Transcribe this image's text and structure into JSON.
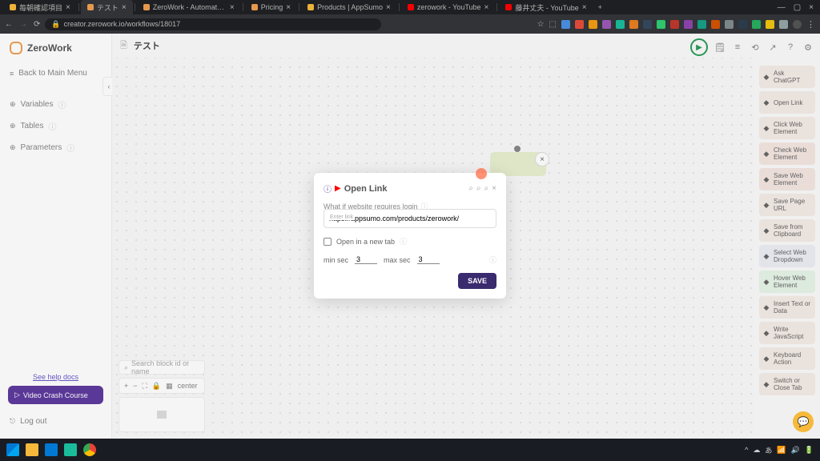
{
  "browser": {
    "tabs": [
      {
        "title": "毎朝確認項目",
        "favicon": "#f6b93b"
      },
      {
        "title": "テスト",
        "favicon": "#f0a050",
        "active": true
      },
      {
        "title": "ZeroWork - Automate repetiti…",
        "favicon": "#f0a050"
      },
      {
        "title": "Pricing",
        "favicon": "#f0a050"
      },
      {
        "title": "Products | AppSumo",
        "favicon": "#f6b93b"
      },
      {
        "title": "zerowork - YouTube",
        "favicon": "#ff0000"
      },
      {
        "title": "藤井丈夫 - YouTube",
        "favicon": "#ff0000"
      }
    ],
    "url": "creator.zerowork.io/workflows/18017"
  },
  "app": {
    "brand": "ZeroWork",
    "nav_back": "Back to Main Menu",
    "nav_items": [
      "Variables",
      "Tables",
      "Parameters"
    ],
    "help_link": "See help docs",
    "crash_btn": "Video Crash Course",
    "logout": "Log out",
    "workflow_title": "テスト",
    "search_placeholder": "Search block id or name",
    "zoom_center": "center"
  },
  "actions": [
    {
      "label": "Ask ChatGPT",
      "cls": ""
    },
    {
      "label": "Open Link",
      "cls": ""
    },
    {
      "label": "Click Web Element",
      "cls": ""
    },
    {
      "label": "Check Web Element",
      "cls": "alt1"
    },
    {
      "label": "Save Web Element",
      "cls": "alt1"
    },
    {
      "label": "Save Page URL",
      "cls": ""
    },
    {
      "label": "Save from Clipboard",
      "cls": ""
    },
    {
      "label": "Select Web Dropdown",
      "cls": "alt3"
    },
    {
      "label": "Hover Web Element",
      "cls": "alt2"
    },
    {
      "label": "Insert Text or Data",
      "cls": ""
    },
    {
      "label": "Write JavaScript",
      "cls": ""
    },
    {
      "label": "Keyboard Action",
      "cls": ""
    },
    {
      "label": "Switch or Close Tab",
      "cls": ""
    }
  ],
  "modal": {
    "title": "Open Link",
    "hint": "What if website requires login",
    "input_label": "Enter link",
    "url_value": "https://appsumo.com/products/zerowork/",
    "newtab_label": "Open in a new tab",
    "min_label": "min sec",
    "min_value": "3",
    "max_label": "max sec",
    "max_value": "3",
    "save": "SAVE"
  }
}
